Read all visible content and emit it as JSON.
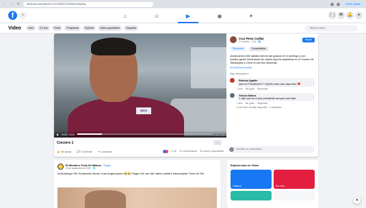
{
  "browser": {
    "url": "facebook.com/watch/?v=1073615271620&ref=sharing",
    "update_label": "Finish update",
    "nav_back": "←",
    "nav_forward": "→",
    "nav_reload": "↻"
  },
  "topbar": {
    "logo": "f",
    "search_glyph": "⌕",
    "nav": [
      {
        "name": "home",
        "glyph": "⌂"
      },
      {
        "name": "friends",
        "glyph": "☺"
      },
      {
        "name": "watch",
        "glyph": "▶"
      },
      {
        "name": "groups",
        "glyph": "◉"
      },
      {
        "name": "gaming",
        "glyph": "✦"
      }
    ],
    "right_icons": [
      "⋮⋮",
      "✉",
      "🔔",
      "●"
    ]
  },
  "video_nav": {
    "title": "Video",
    "pills": [
      "Inicio",
      "En vivo",
      "Reels",
      "Programas",
      "Explorar",
      "Videos guardados",
      "Seguidos"
    ],
    "search_placeholder": "Buscar videos"
  },
  "player": {
    "caption": "Creciero 1",
    "badge_text": "BIEN",
    "time": "0:00 / 3:21",
    "progress": 0.18,
    "more_label": "···",
    "actions": {
      "like": "Me gusta",
      "comment": "Comentar",
      "share": "Compartir",
      "stats": [
        "1.1K",
        "21 comentarios",
        "10 veces compartido"
      ]
    }
  },
  "side_panel": {
    "page_name": "Cruz Pérez Cuéllar",
    "time": "27 de julio · 1:03 · 🌐",
    "follow_label": "Seguir",
    "tabs": [
      "Recientes",
      "Comentarios"
    ],
    "description": "¡Arrancamos este sábado siendo tan guapos en el domingo y con nuestra gente! Iluminando los cubres aquí la esperanza en el Crucero de Tamaulipas y Creek en las tres Modrinas.",
    "hashtags": "#CruzPérezCuéllar",
    "section_label": "Más relevantes ▾",
    "comments": [
      {
        "name": "Patricia Ugalde",
        "text": "Que es Presidente!!! Y Quinto hace que vaya todo ❤️",
        "meta": [
          "1 sem",
          "Me gusta",
          "Responder"
        ],
        "replies": ""
      },
      {
        "name": "Yesica Gámez",
        "text": "Y ojito que es el que presidente aunque solo trate",
        "meta": [
          "1 sem",
          "Me gusta",
          "Responder"
        ],
        "replies": "Cruz Pérez Cuéllar respondió · 1 respuesta"
      }
    ],
    "comment_placeholder": "Escribe un comentario..."
  },
  "feed_post": {
    "page": "El Wonders Trivia De Matuzo",
    "follow": "· Seguir",
    "date": "12 de septiembre de 2022 · 🌐",
    "text": "Drofundingo Oh! Homenelia Hecho Juan Angendoreer 😂😂 Polgen De van Wir haben weiters interessante Think für Sie."
  },
  "explore": {
    "title": "Explora más en Video",
    "cards": [
      "Vídeos",
      "En vivo",
      "",
      ""
    ]
  },
  "fab": "✕",
  "colors": {
    "brand": "#1877f2",
    "shirt": "#7a1f3d",
    "bg": "#f0f2f5"
  }
}
